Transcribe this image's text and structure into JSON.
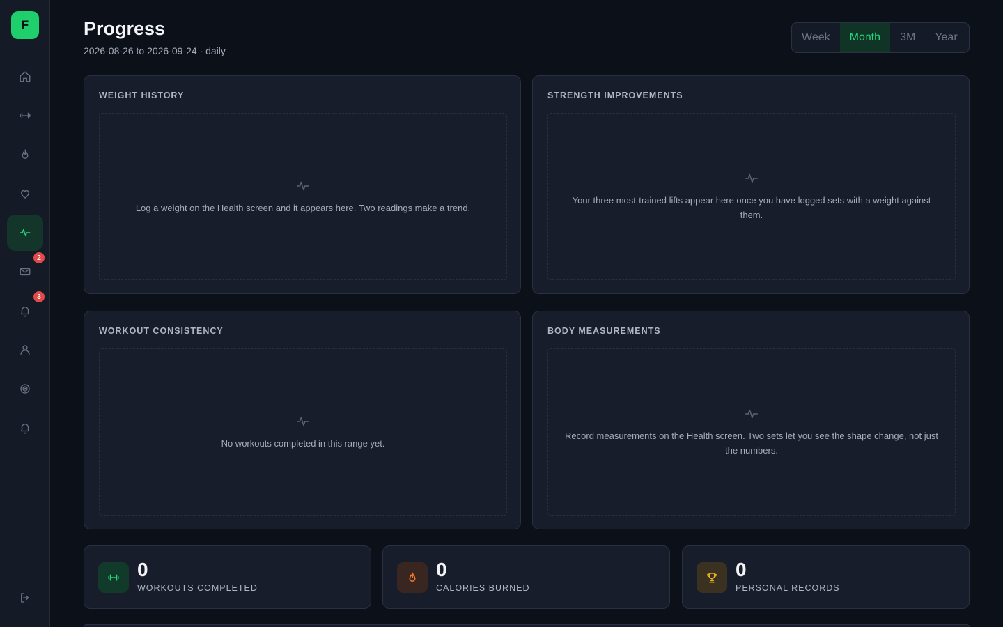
{
  "app": {
    "logo_letter": "F"
  },
  "sidebar": {
    "items": [
      {
        "name": "home",
        "icon": "home-icon"
      },
      {
        "name": "workouts",
        "icon": "dumbbell-icon"
      },
      {
        "name": "nutrition",
        "icon": "flame-icon"
      },
      {
        "name": "health",
        "icon": "heart-icon"
      },
      {
        "name": "progress",
        "icon": "activity-icon",
        "active": true
      },
      {
        "name": "messages",
        "icon": "mail-icon",
        "badge": "2"
      },
      {
        "name": "notifications",
        "icon": "bell-icon",
        "badge": "3"
      },
      {
        "name": "profile",
        "icon": "user-icon"
      },
      {
        "name": "goals",
        "icon": "target-icon"
      },
      {
        "name": "reminders",
        "icon": "bell-icon"
      }
    ],
    "logout_icon": "logout-icon"
  },
  "header": {
    "title": "Progress",
    "subtitle": "2026-08-26 to 2026-09-24 · daily"
  },
  "range_tabs": [
    {
      "label": "Week"
    },
    {
      "label": "Month",
      "active": true
    },
    {
      "label": "3M"
    },
    {
      "label": "Year"
    }
  ],
  "cards": {
    "weight": {
      "title": "WEIGHT HISTORY",
      "empty": "Log a weight on the Health screen and it appears here. Two readings make a trend."
    },
    "strength": {
      "title": "STRENGTH IMPROVEMENTS",
      "empty": "Your three most-trained lifts appear here once you have logged sets with a weight against them."
    },
    "consistency": {
      "title": "WORKOUT CONSISTENCY",
      "empty": "No workouts completed in this range yet."
    },
    "measurements": {
      "title": "BODY MEASUREMENTS",
      "empty": "Record measurements on the Health screen. Two sets let you see the shape change, not just the numbers."
    }
  },
  "stats": {
    "workouts": {
      "value": "0",
      "label": "WORKOUTS COMPLETED",
      "color": "#27d47a"
    },
    "calories": {
      "value": "0",
      "label": "CALORIES BURNED",
      "color": "#f07a2a"
    },
    "records": {
      "value": "0",
      "label": "PERSONAL RECORDS",
      "color": "#e8b020"
    }
  },
  "colors": {
    "accent": "#27d47a",
    "badge": "#e24a4a",
    "background": "#0c1018",
    "card": "#171d2a"
  }
}
